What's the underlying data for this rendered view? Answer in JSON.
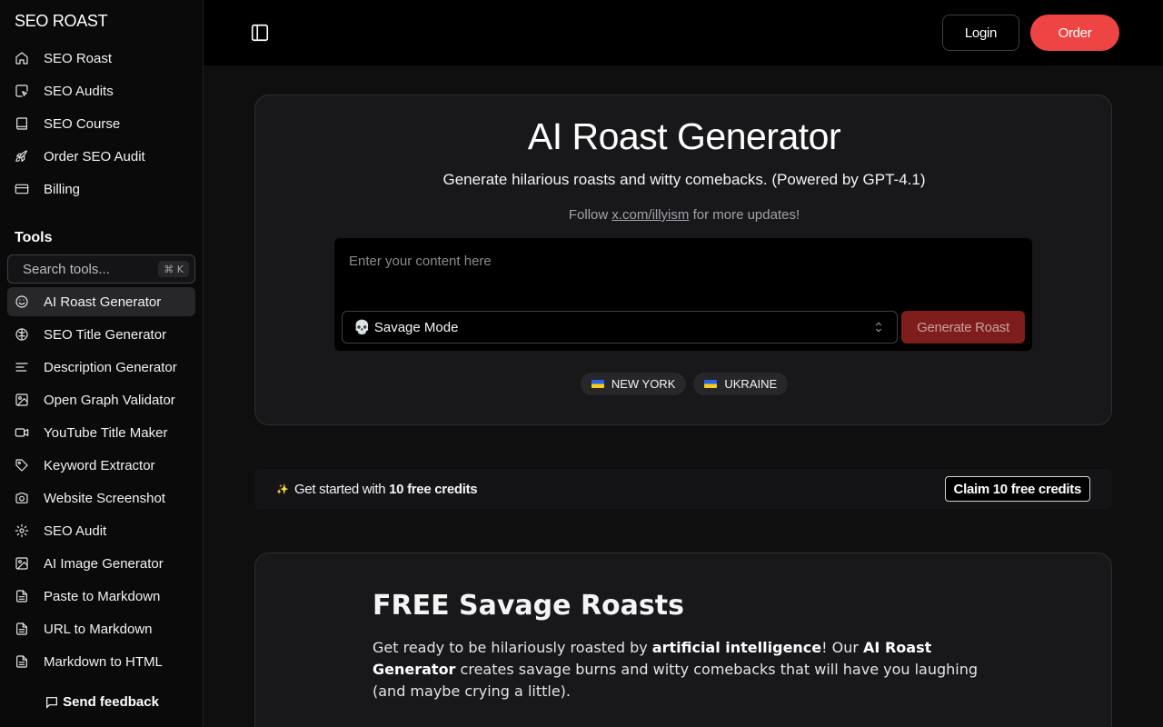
{
  "sidebar": {
    "brand": "SEO ROAST",
    "nav": [
      {
        "label": "SEO Roast",
        "icon": "home-icon"
      },
      {
        "label": "SEO Audits",
        "icon": "audit-icon"
      },
      {
        "label": "SEO Course",
        "icon": "book-icon"
      },
      {
        "label": "Order SEO Audit",
        "icon": "rocket-icon"
      },
      {
        "label": "Billing",
        "icon": "credit-card-icon"
      }
    ],
    "tools_title": "Tools",
    "search_placeholder": "Search tools...",
    "search_shortcut": "⌘ K",
    "tools": [
      {
        "label": "AI Roast Generator",
        "icon": "smile-icon",
        "active": true
      },
      {
        "label": "SEO Title Generator",
        "icon": "brain-icon"
      },
      {
        "label": "Description Generator",
        "icon": "align-left-icon"
      },
      {
        "label": "Open Graph Validator",
        "icon": "image-icon"
      },
      {
        "label": "YouTube Title Maker",
        "icon": "video-icon"
      },
      {
        "label": "Keyword Extractor",
        "icon": "tag-icon"
      },
      {
        "label": "Website Screenshot",
        "icon": "camera-icon"
      },
      {
        "label": "SEO Audit",
        "icon": "gear-icon"
      },
      {
        "label": "AI Image Generator",
        "icon": "image-icon"
      },
      {
        "label": "Paste to Markdown",
        "icon": "file-icon"
      },
      {
        "label": "URL to Markdown",
        "icon": "file-icon"
      },
      {
        "label": "Markdown to HTML",
        "icon": "file-icon"
      }
    ],
    "feedback": "Send feedback"
  },
  "header": {
    "login": "Login",
    "order": "Order"
  },
  "hero": {
    "title": "AI Roast Generator",
    "subtitle": "Generate hilarious roasts and witty comebacks. (Powered by GPT-4.1)",
    "follow_prefix": "Follow",
    "follow_link": "x.com/illyism",
    "follow_suffix": "for more updates!",
    "input_placeholder": "Enter your content here",
    "mode": "💀 Savage Mode",
    "generate": "Generate Roast",
    "chips": [
      "NEW YORK",
      "UKRAINE"
    ]
  },
  "credits": {
    "prefix": "Get started with",
    "bold": "10 free credits",
    "claim": "Claim 10 free credits"
  },
  "content": {
    "heading": "FREE Savage Roasts",
    "p1": "Get ready to be hilariously roasted by",
    "p1b": "artificial intelligence",
    "p2": "! Our",
    "p2b": "AI Roast Generator",
    "p3": "creates savage burns and witty comebacks that will have you laughing (and maybe crying a little)."
  },
  "colors": {
    "accent": "#ef4444",
    "background": "#0f0f10"
  }
}
